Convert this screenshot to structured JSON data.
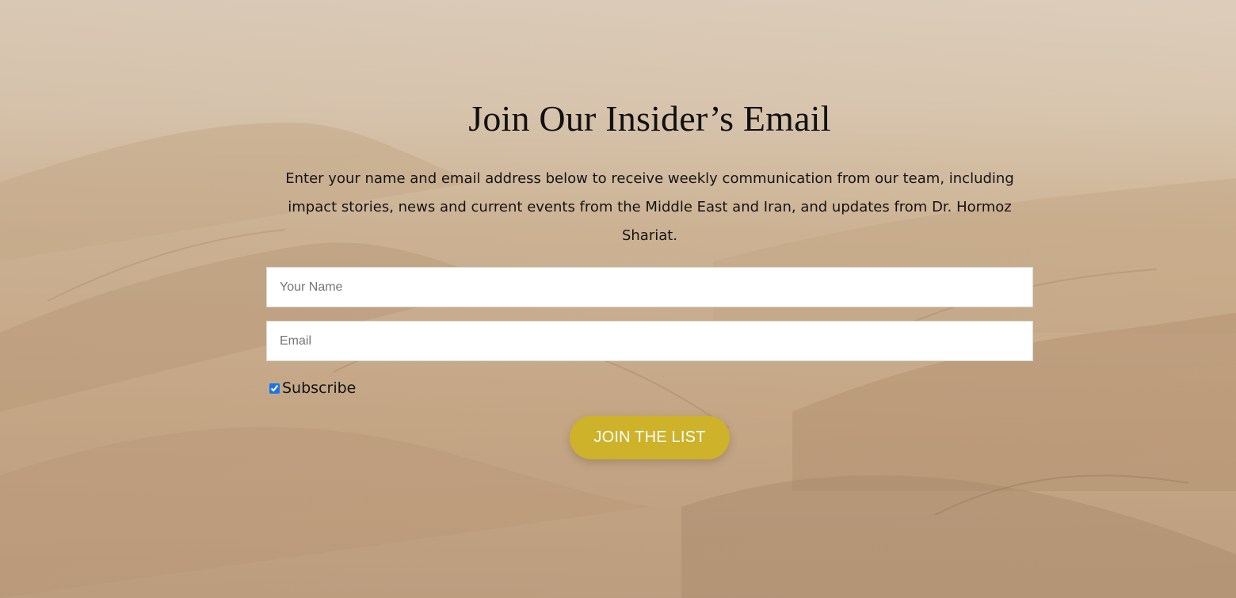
{
  "signup": {
    "title": "Join Our Insider’s Email",
    "intro": "Enter your name and email address below to receive weekly communication from our team, including impact stories, news and current events from the Middle East and Iran, and updates from Dr. Hormoz Shariat.",
    "name_placeholder": "Your Name",
    "email_placeholder": "Email",
    "subscribe_label": "Subscribe",
    "subscribe_checked": true,
    "button_label": "JOIN THE LIST"
  },
  "colors": {
    "button": "#cdb22a",
    "sand": "#cdb394",
    "haze": "#e2d4c2",
    "text": "#111111"
  }
}
